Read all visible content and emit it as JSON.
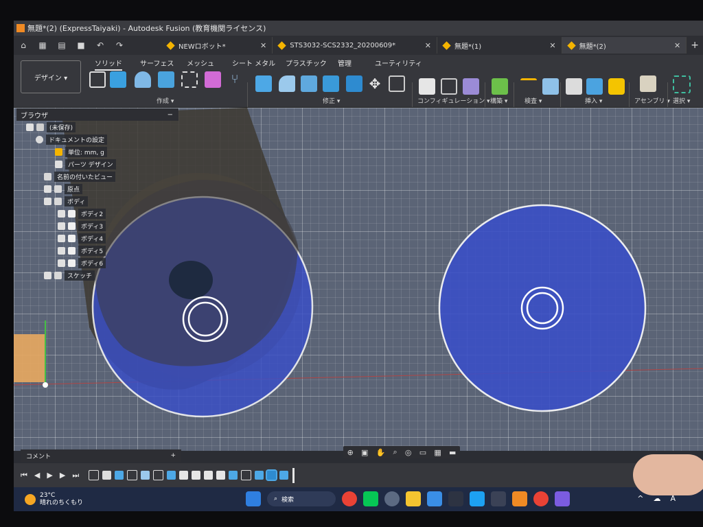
{
  "window": {
    "title": "無題*(2) (ExpressTaiyaki) - Autodesk Fusion (教育機関ライセンス)"
  },
  "doc_tabs": [
    {
      "label": "NEWロボット*",
      "active": false
    },
    {
      "label": "STS3032-SCS2332_20200609*",
      "active": false
    },
    {
      "label": "無題*(1)",
      "active": false
    },
    {
      "label": "無題*(2)",
      "active": true
    }
  ],
  "ribbon": {
    "workspace": "デザイン ▾",
    "tabs": [
      "ソリッド",
      "サーフェス",
      "メッシュ",
      "シート メタル",
      "プラスチック",
      "管理",
      "ユーティリティ"
    ],
    "groups": [
      "作成 ▾",
      "修正 ▾",
      "コンフィギュレーション ▾",
      "構築 ▾",
      "検査 ▾",
      "挿入 ▾",
      "アセンブリ ▾",
      "選択 ▾"
    ]
  },
  "browser": {
    "title": "ブラウザ",
    "items": [
      {
        "label": "(未保存)"
      },
      {
        "label": "ドキュメントの設定"
      },
      {
        "label": "単位: mm, g"
      },
      {
        "label": "パーツ デザイン"
      },
      {
        "label": "名前の付いたビュー"
      },
      {
        "label": "原点"
      },
      {
        "label": "ボディ"
      },
      {
        "label": "ボディ2"
      },
      {
        "label": "ボディ3"
      },
      {
        "label": "ボディ4"
      },
      {
        "label": "ボディ5"
      },
      {
        "label": "ボディ6"
      },
      {
        "label": "スケッチ"
      }
    ]
  },
  "comment_bar": {
    "label": "コメント",
    "plus": "+"
  },
  "taskbar": {
    "temperature": "23°C",
    "weather": "晴れのちくもり",
    "search": "検索",
    "tray": [
      "^",
      "A"
    ]
  },
  "colors": {
    "viewport_bg": "#5b6476",
    "selection_blue": "#3a4fc8",
    "accent": "#f4b400"
  }
}
